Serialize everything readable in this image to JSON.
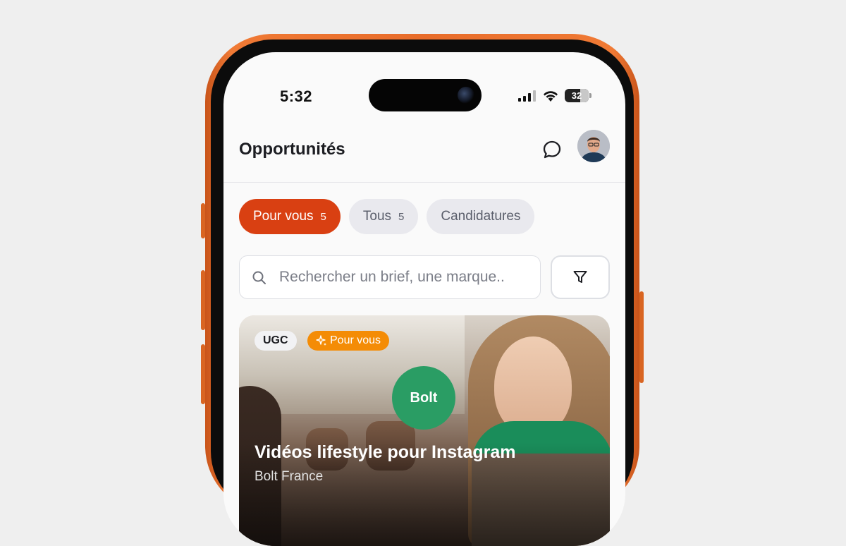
{
  "status_bar": {
    "time": "5:32",
    "battery": "32"
  },
  "header": {
    "title": "Opportunités"
  },
  "tabs": [
    {
      "label": "Pour vous",
      "count": "5"
    },
    {
      "label": "Tous",
      "count": "5"
    },
    {
      "label": "Candidatures"
    }
  ],
  "search": {
    "placeholder": "Rechercher un brief, une marque.."
  },
  "card": {
    "badges": [
      "UGC",
      "Pour vous"
    ],
    "brand_logo": "Bolt",
    "title": "Vidéos lifestyle pour Instagram",
    "subtitle": "Bolt France"
  },
  "colors": {
    "accent": "#d94012",
    "frame": "#e86c2a",
    "badge_orange": "#f48c06",
    "brand_green": "#2a9d64"
  },
  "icons": [
    "signal-icon",
    "wifi-icon",
    "battery-icon",
    "chat-icon",
    "avatar",
    "search-icon",
    "filter-icon",
    "sparkle-icon"
  ]
}
